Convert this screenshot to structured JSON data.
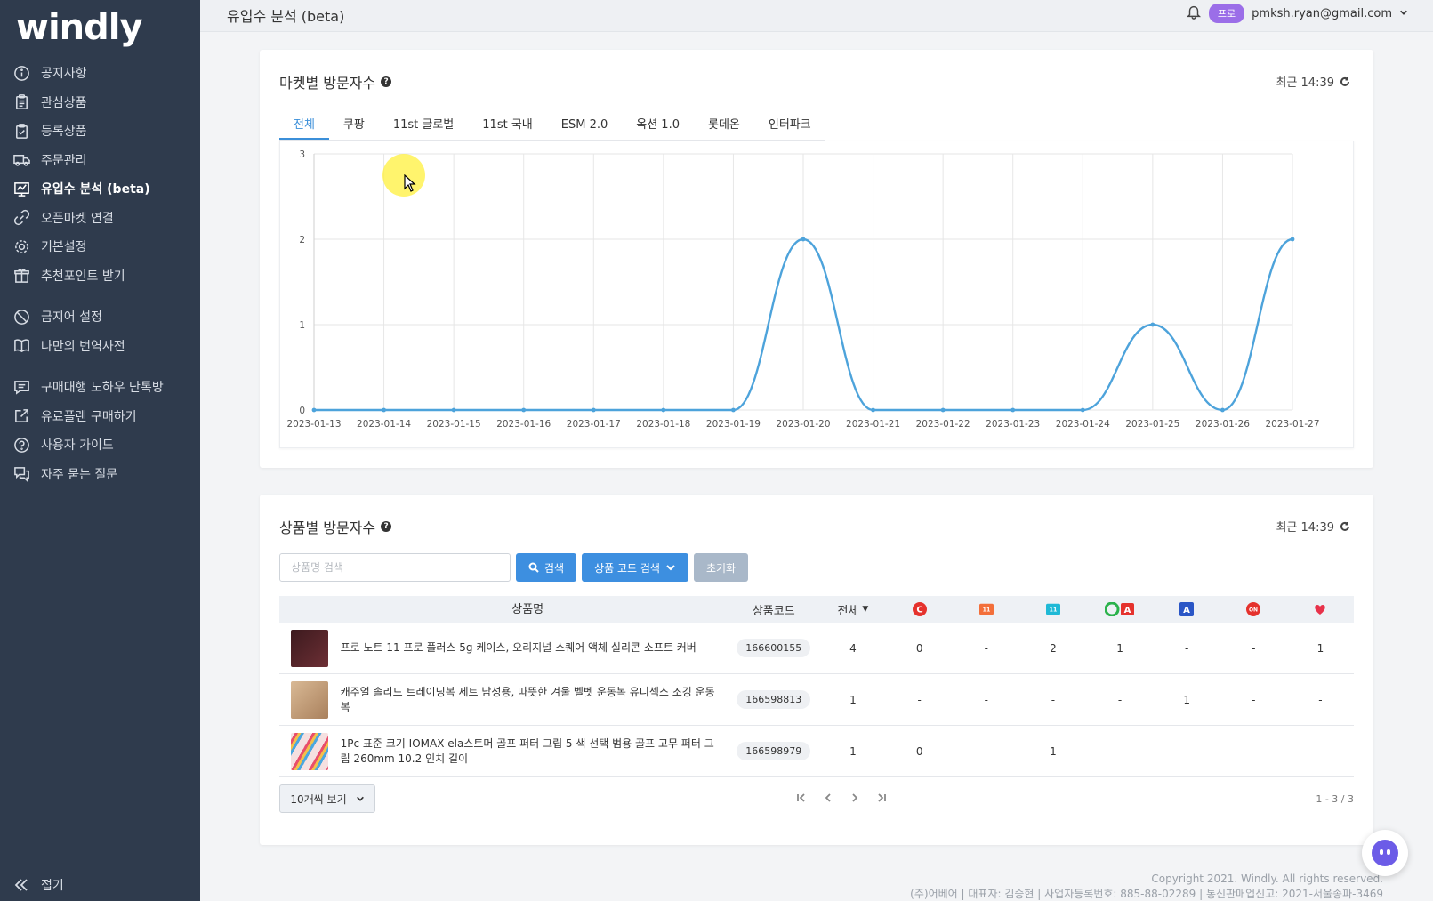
{
  "sidebar": {
    "logo": "windly",
    "items": [
      {
        "label": "공지사항",
        "icon": "info-icon"
      },
      {
        "label": "관심상품",
        "icon": "clipboard-icon"
      },
      {
        "label": "등록상품",
        "icon": "clipboard-check-icon"
      },
      {
        "label": "주문관리",
        "icon": "truck-icon"
      },
      {
        "label": "유입수 분석 (beta)",
        "icon": "chart-icon"
      },
      {
        "label": "오픈마켓 연결",
        "icon": "link-icon"
      },
      {
        "label": "기본설정",
        "icon": "gear-icon"
      },
      {
        "label": "추천포인트 받기",
        "icon": "gift-icon"
      },
      {
        "label": "금지어 설정",
        "icon": "ban-icon"
      },
      {
        "label": "나만의 번역사전",
        "icon": "book-icon"
      },
      {
        "label": "구매대행 노하우 단톡방",
        "icon": "chat-icon"
      },
      {
        "label": "유료플랜 구매하기",
        "icon": "external-link-icon"
      },
      {
        "label": "사용자 가이드",
        "icon": "question-icon"
      },
      {
        "label": "자주 묻는 질문",
        "icon": "comments-icon"
      }
    ],
    "collapse_label": "접기"
  },
  "topbar": {
    "title": "유입수 분석 (beta)",
    "badge": "프로",
    "email": "pmksh.ryan@gmail.com"
  },
  "market_card": {
    "title": "마켓별 방문자수",
    "recent": "최근 14:39",
    "tabs": [
      "전체",
      "쿠팡",
      "11st 글로벌",
      "11st 국내",
      "ESM 2.0",
      "옥션 1.0",
      "롯데온",
      "인터파크"
    ],
    "active_tab": "전체"
  },
  "chart_data": {
    "type": "line",
    "x": [
      "2023-01-13",
      "2023-01-14",
      "2023-01-15",
      "2023-01-16",
      "2023-01-17",
      "2023-01-18",
      "2023-01-19",
      "2023-01-20",
      "2023-01-21",
      "2023-01-22",
      "2023-01-23",
      "2023-01-24",
      "2023-01-25",
      "2023-01-26",
      "2023-01-27"
    ],
    "values": [
      0,
      0,
      0,
      0,
      0,
      0,
      0,
      2,
      0,
      0,
      0,
      0,
      1,
      0,
      2
    ],
    "ylim": [
      0,
      3
    ],
    "yticks": [
      0,
      1,
      2,
      3
    ],
    "grid": true,
    "color": "#4da3db"
  },
  "product_card": {
    "title": "상품별 방문자수",
    "recent": "최근 14:39",
    "search_placeholder": "상품명 검색",
    "search_btn": "검색",
    "code_search_btn": "상품 코드 검색",
    "reset_btn": "초기화",
    "columns": {
      "name": "상품명",
      "code": "상품코드",
      "all": "전체"
    },
    "markets": [
      {
        "icon": "coupang-icon",
        "color": "#e5322d",
        "label": "C"
      },
      {
        "icon": "11st-global-icon",
        "color": "#f36f3a",
        "label": "11"
      },
      {
        "icon": "11st-domestic-icon",
        "color": "#1fb9d6",
        "label": "11"
      },
      {
        "icon": "gmarket-auction-icon",
        "color": "#2bb24c",
        "label": "GA"
      },
      {
        "icon": "auction-icon",
        "color": "#2a56c6",
        "label": "A"
      },
      {
        "icon": "lotteon-icon",
        "color": "#e5322d",
        "label": "ON"
      },
      {
        "icon": "interpark-heart-icon",
        "color": "#e8324a",
        "label": ""
      }
    ],
    "rows": [
      {
        "name": "프로 노트 11 프로 플러스 5g 케이스, 오리지널 스퀘어 액체 실리콘 소프트 커버",
        "code": "166600155",
        "all": "4",
        "m": [
          "0",
          "-",
          "2",
          "1",
          "-",
          "-",
          "1"
        ],
        "thumb": "#5a2a2e"
      },
      {
        "name": "캐주얼 솔리드 트레이닝복 세트 남성용, 따뜻한 겨울 벨벳 운동복 유니섹스 조깅 운동복",
        "code": "166598813",
        "all": "1",
        "m": [
          "-",
          "-",
          "-",
          "-",
          "1",
          "-",
          "-"
        ],
        "thumb": "#c8a27c"
      },
      {
        "name": "1Pc 표준 크기 IOMAX ela스트머 골프 퍼터 그립 5 색 선택 범용 골프 고무 퍼터 그립 260mm 10.2 인치 길이",
        "code": "166598979",
        "all": "1",
        "m": [
          "0",
          "-",
          "1",
          "-",
          "-",
          "-",
          "-"
        ],
        "thumb": "#f5e7e7"
      }
    ],
    "page_size": "10개씩 보기",
    "page_info": "1 - 3 / 3"
  },
  "footer": {
    "copyright": "Copyright 2021. Windly. All rights reserved.",
    "company": "(주)어베어 | 대표자: 김승현 | 사업자등록번호: 885-88-02289 | 통신판매업신고: 2021-서울송파-3469"
  }
}
